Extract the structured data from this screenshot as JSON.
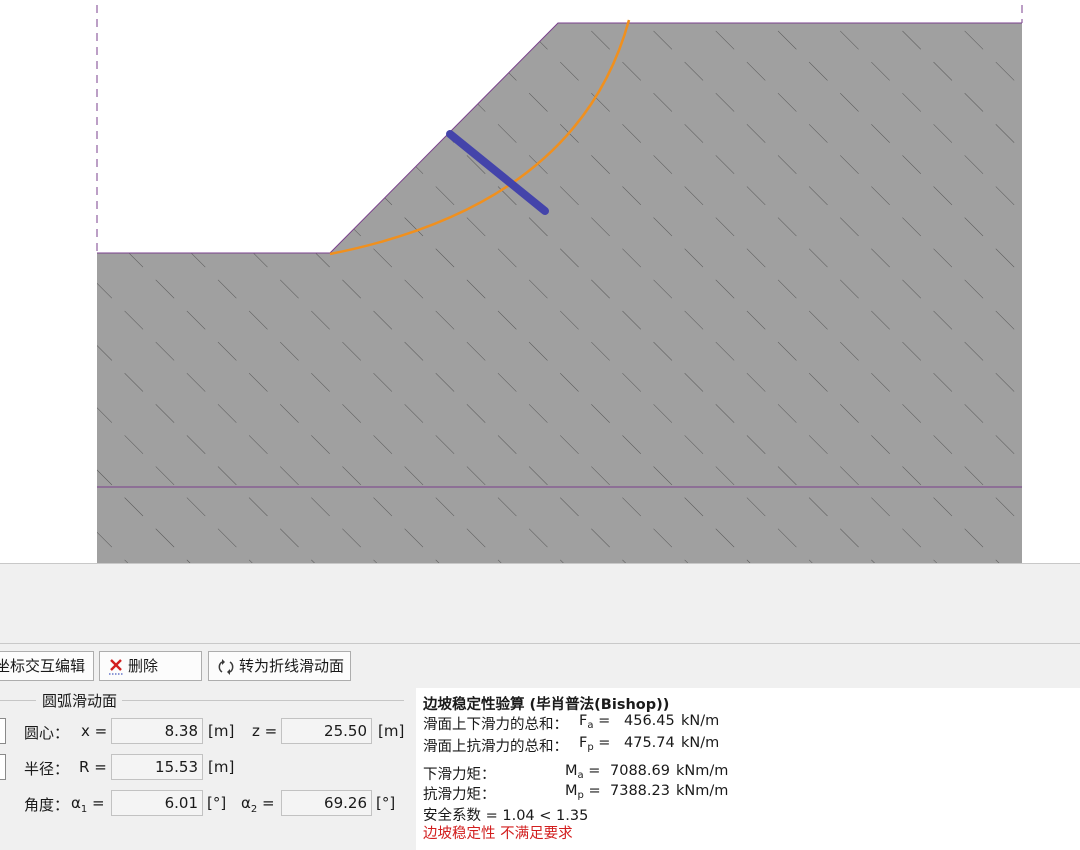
{
  "toolbar": {
    "edit_label": "坐标交互编辑",
    "delete_label": "删除",
    "convert_label": "转为折线滑动面"
  },
  "circle_group": {
    "title": "圆弧滑动面",
    "center_label": "圆心：",
    "x_label": "x =",
    "x_value": "8.38",
    "x_unit": "[m]",
    "z_label": "z =",
    "z_value": "25.50",
    "z_unit": "[m]",
    "radius_label": "半径：",
    "r_label": "R =",
    "r_value": "15.53",
    "r_unit": "[m]",
    "angle_label": "角度：",
    "a1_label": "α",
    "a1_sub": "1",
    "a1_eq": " =",
    "a1_value": "6.01",
    "a1_unit": "[°]",
    "a2_label": "α",
    "a2_sub": "2",
    "a2_eq": " =",
    "a2_value": "69.26",
    "a2_unit": "[°]"
  },
  "results": {
    "title": "边坡稳定性验算 (毕肖普法(Bishop))",
    "fa_label": "滑面上下滑力的总和：",
    "fa_sym": "F",
    "fa_sub": "a",
    "fa_eq": " =",
    "fa_value": "456.45",
    "fa_unit": "kN/m",
    "fp_label": "滑面上抗滑力的总和：",
    "fp_sym": "F",
    "fp_sub": "p",
    "fp_eq": " =",
    "fp_value": "475.74",
    "fp_unit": "kN/m",
    "ma_label": "下滑力矩：",
    "ma_sym": "M",
    "ma_sub": "a",
    "ma_eq": " =",
    "ma_value": "7088.69",
    "ma_unit": "kNm/m",
    "mp_label": "抗滑力矩：",
    "mp_sym": "M",
    "mp_sub": "p",
    "mp_eq": " =",
    "mp_value": "7388.23",
    "mp_unit": "kNm/m",
    "fs_text": "安全系数 = 1.04 < 1.35",
    "verdict_prefix": "边坡稳定性",
    "verdict_text": "不满足要求"
  },
  "colors": {
    "soil": "#a0a0a0",
    "hatch": "#4a4a4a",
    "boundary": "#7a3f8c",
    "slip_arc": "#f0901e",
    "marker": "#4444aa",
    "fail_text": "#d21e1e"
  }
}
